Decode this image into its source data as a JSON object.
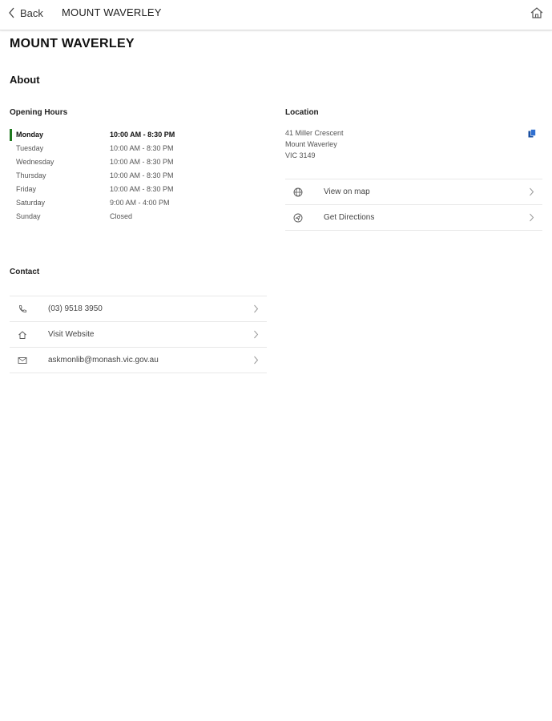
{
  "header": {
    "back_label": "Back",
    "title": "MOUNT WAVERLEY"
  },
  "page": {
    "title": "MOUNT WAVERLEY",
    "about_heading": "About"
  },
  "opening_hours": {
    "heading": "Opening Hours",
    "rows": [
      {
        "day": "Monday",
        "time": "10:00 AM - 8:30 PM",
        "today": true
      },
      {
        "day": "Tuesday",
        "time": "10:00 AM - 8:30 PM"
      },
      {
        "day": "Wednesday",
        "time": "10:00 AM - 8:30 PM"
      },
      {
        "day": "Thursday",
        "time": "10:00 AM - 8:30 PM"
      },
      {
        "day": "Friday",
        "time": "10:00 AM - 8:30 PM"
      },
      {
        "day": "Saturday",
        "time": "9:00 AM - 4:00 PM"
      },
      {
        "day": "Sunday",
        "time": "Closed"
      }
    ],
    "today_marker_color": "#1f7a1f"
  },
  "location": {
    "heading": "Location",
    "address_lines": [
      "41 Miller Crescent",
      "Mount Waverley",
      "VIC 3149"
    ],
    "actions": [
      {
        "label": "View on map",
        "icon": "globe-icon"
      },
      {
        "label": "Get Directions",
        "icon": "directions-icon"
      }
    ]
  },
  "contact": {
    "heading": "Contact",
    "items": [
      {
        "label": "(03) 9518 3950",
        "icon": "phone-icon"
      },
      {
        "label": "Visit Website",
        "icon": "home-icon"
      },
      {
        "label": "askmonlib@monash.vic.gov.au",
        "icon": "mail-icon"
      }
    ]
  },
  "colors": {
    "accent": "#1f7a1f",
    "copy_icon": "#1a4fa0"
  }
}
